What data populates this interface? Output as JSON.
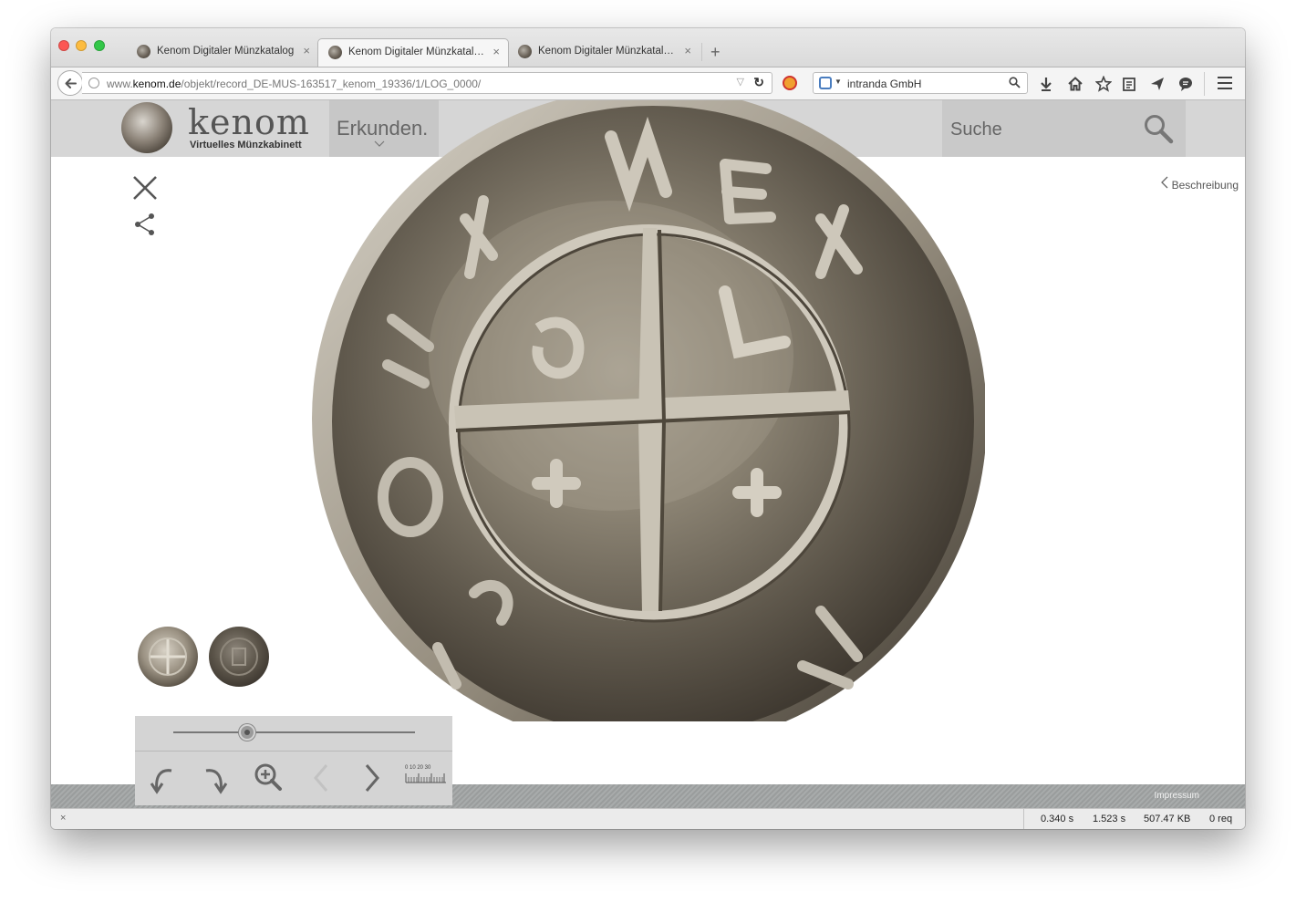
{
  "browser": {
    "tabs": [
      {
        "title": "Kenom Digitaler Münzkatalog",
        "active": false
      },
      {
        "title": "Kenom Digitaler Münzkatalo…",
        "active": true
      },
      {
        "title": "Kenom Digitaler Münzkatalo…",
        "active": false
      }
    ],
    "tab_close_glyph": "×",
    "new_tab_glyph": "+",
    "url": {
      "prefix": "www.",
      "domain": "kenom.de",
      "path": "/objekt/record_DE-MUS-163517_kenom_19336/1/LOG_0000/"
    },
    "search_engine_label": "intranda GmbH",
    "toolbar_icons": [
      "download-icon",
      "home-icon",
      "bookmark-star-icon",
      "reading-list-icon",
      "send-icon",
      "chat-icon",
      "menu-icon"
    ]
  },
  "site": {
    "logo_name": "kenom",
    "logo_subtitle": "Virtuelles Münzkabinett",
    "nav_explore": "Erkunden.",
    "search_placeholder": "Suche",
    "description_link": "Beschreibung",
    "footer_link": "Impressum"
  },
  "viewer": {
    "zoom_slider_value": 0.3,
    "scale_numbers": "0 10 20 30",
    "controls": [
      "rotate-left-icon",
      "rotate-right-icon",
      "zoom-in-icon",
      "previous-icon",
      "next-icon",
      "scale-ruler-icon"
    ],
    "thumbnails": [
      "coin-obverse-thumbnail",
      "coin-reverse-thumbnail"
    ]
  },
  "statusbar": {
    "close_glyph": "×",
    "time1": "0.340 s",
    "time2": "1.523 s",
    "size": "507.47 KB",
    "requests": "0 req"
  },
  "colors": {
    "header_bg": "#d6d6d6",
    "explore_bg": "#c7c7c7",
    "controls_bg": "#d4d4d4",
    "footer_band": "#a0a3a3",
    "coin_silver": "#b9b3a6",
    "coin_dark": "#4a4339"
  }
}
